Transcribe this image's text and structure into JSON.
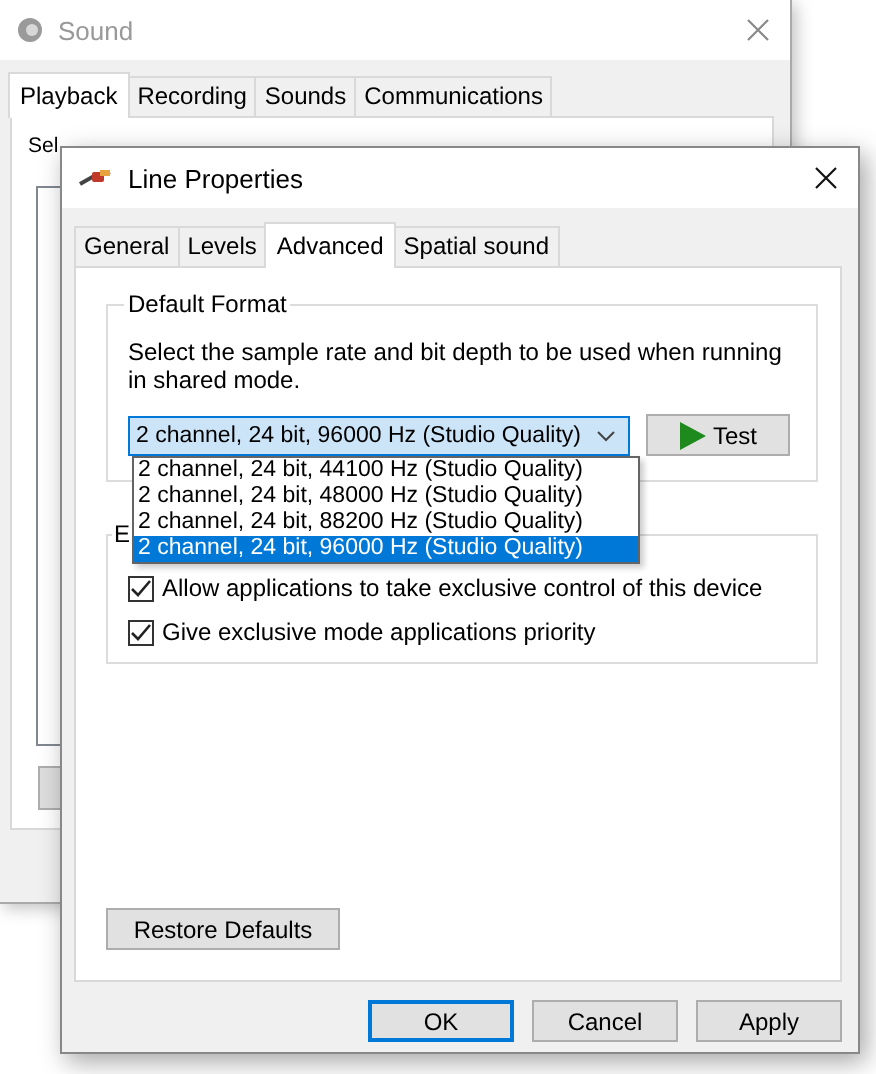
{
  "sound_window": {
    "title": "Sound",
    "tabs": [
      {
        "label": "Playback",
        "selected": true
      },
      {
        "label": "Recording",
        "selected": false
      },
      {
        "label": "Sounds",
        "selected": false
      },
      {
        "label": "Communications",
        "selected": false
      }
    ],
    "instruction": "Sel"
  },
  "dialog": {
    "title": "Line Properties",
    "tabs": [
      {
        "label": "General",
        "selected": false
      },
      {
        "label": "Levels",
        "selected": false
      },
      {
        "label": "Advanced",
        "selected": true
      },
      {
        "label": "Spatial sound",
        "selected": false
      }
    ],
    "default_format": {
      "label": "Default Format",
      "description": "Select the sample rate and bit depth to be used when running in shared mode.",
      "combo": {
        "value": "2 channel, 24 bit, 96000 Hz (Studio Quality)",
        "expanded": true
      },
      "options": [
        {
          "label": "2 channel, 24 bit, 44100 Hz (Studio Quality)",
          "selected": false
        },
        {
          "label": "2 channel, 24 bit, 48000 Hz (Studio Quality)",
          "selected": false
        },
        {
          "label": "2 channel, 24 bit, 88200 Hz (Studio Quality)",
          "selected": false
        },
        {
          "label": "2 channel, 24 bit, 96000 Hz (Studio Quality)",
          "selected": true
        }
      ],
      "test_button": "Test"
    },
    "exclusive_mode": {
      "label": "E",
      "options": [
        {
          "label": "Allow applications to take exclusive control of this device",
          "checked": true
        },
        {
          "label": "Give exclusive mode applications priority",
          "checked": true
        }
      ]
    },
    "restore_button": "Restore Defaults",
    "buttons": [
      {
        "label": "OK",
        "default": true
      },
      {
        "label": "Cancel",
        "default": false
      },
      {
        "label": "Apply",
        "default": false
      }
    ]
  }
}
